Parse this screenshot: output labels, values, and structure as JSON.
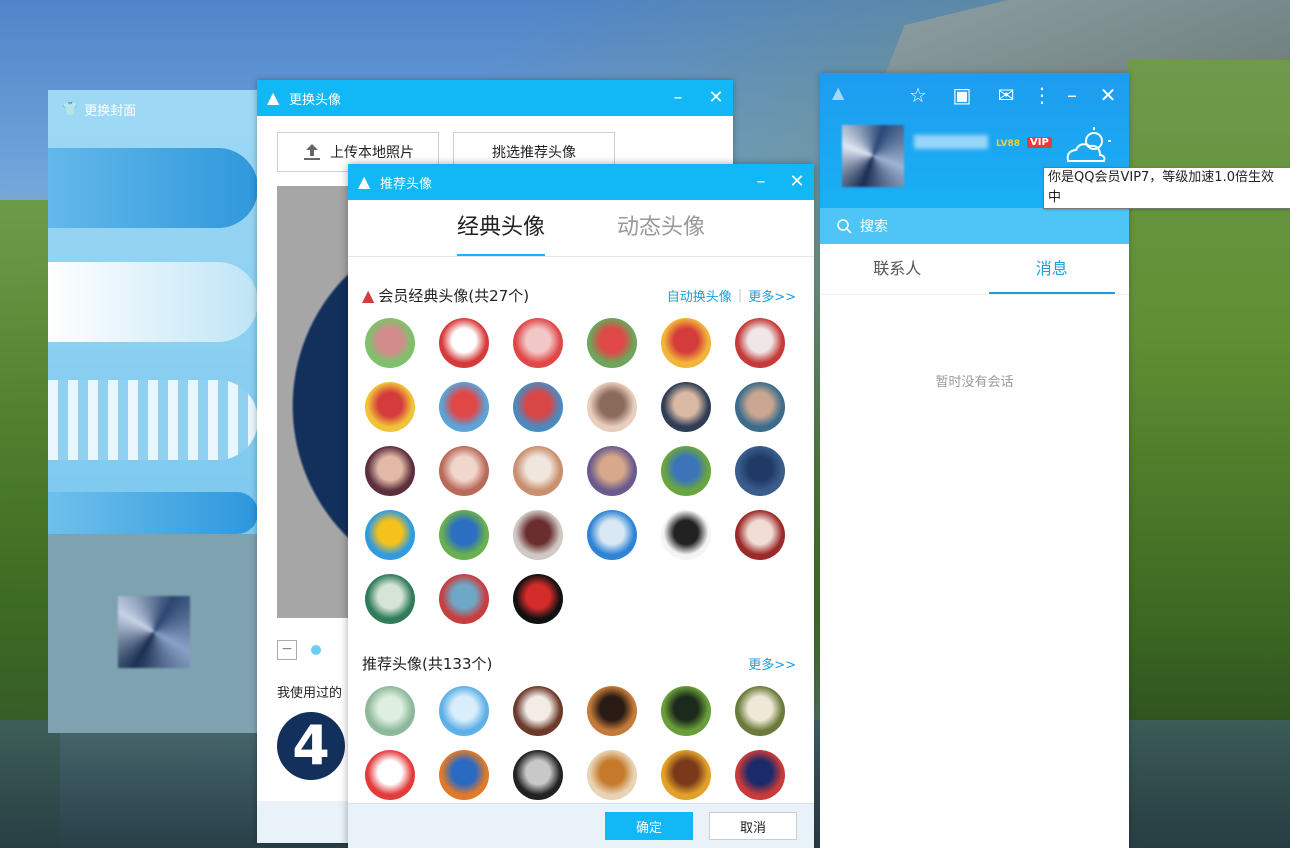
{
  "cover_window": {
    "title": "更换封面"
  },
  "change_avatar": {
    "title": "更换头像",
    "upload_button": "上传本地照片",
    "pick_button": "挑选推荐头像",
    "used_label": "我使用过的",
    "used_avatar_text": "4"
  },
  "recommend": {
    "title": "推荐头像",
    "tabs": [
      "经典头像",
      "动态头像"
    ],
    "vip_section": {
      "title": "会员经典头像(共27个)",
      "auto_link": "自动换头像",
      "more_link": "更多>>"
    },
    "rec_section": {
      "title": "推荐头像(共133个)",
      "more_link": "更多>>"
    },
    "ok_button": "确定",
    "cancel_button": "取消",
    "vip_avatars": [
      [
        "#7ec16a",
        "#d28c8c"
      ],
      [
        "#d63b3b",
        "#ffffff"
      ],
      [
        "#e04848",
        "#f2c7c7"
      ],
      [
        "#6da55a",
        "#e04848"
      ],
      [
        "#f2b53a",
        "#d43b3b"
      ],
      [
        "#c53b3b",
        "#f0e6e6"
      ],
      [
        "#f2c23a",
        "#d43b3b"
      ],
      [
        "#5ba3d8",
        "#e04848"
      ],
      [
        "#4b8ac0",
        "#d84646"
      ],
      [
        "#e9cdbd",
        "#8a6a5a"
      ],
      [
        "#2f3d55",
        "#d9b8a4"
      ],
      [
        "#3b6c8a",
        "#c9a690"
      ],
      [
        "#5b2f3e",
        "#e3b9a6"
      ],
      [
        "#b96b5a",
        "#f1d6cb"
      ],
      [
        "#c98f6e",
        "#f1e6de"
      ],
      [
        "#6b5a8c",
        "#d7a98a"
      ],
      [
        "#6aa63f",
        "#3b74b8"
      ],
      [
        "#3b5d8c",
        "#1f3a66"
      ],
      [
        "#2f9be0",
        "#f4c21a"
      ],
      [
        "#6ab04c",
        "#2b6ec2"
      ],
      [
        "#cfc8c4",
        "#6b2e2e"
      ],
      [
        "#2f83d6",
        "#d8e8f4"
      ],
      [
        "#f4f4f4",
        "#222222"
      ],
      [
        "#9b2a2a",
        "#f1ddd5"
      ],
      [
        "#2f7b5a",
        "#d6e4d8"
      ],
      [
        "#c73e3e",
        "#6fa7c7"
      ],
      [
        "#111111",
        "#d42b2b"
      ]
    ],
    "rec_avatars": [
      [
        "#8fb89a",
        "#dcefe0"
      ],
      [
        "#5fb0e8",
        "#d9eefb"
      ],
      [
        "#6b3a2a",
        "#f2ece5"
      ],
      [
        "#c47a3a",
        "#2a1b14"
      ],
      [
        "#6a9e3a",
        "#1b2a1b"
      ],
      [
        "#6a7a3a",
        "#efe8d6"
      ],
      [
        "#e33a3a",
        "#ffffff"
      ],
      [
        "#e07a2a",
        "#2a6ac2"
      ],
      [
        "#222222",
        "#c8c8c8"
      ],
      [
        "#e8d4b4",
        "#c47a2a"
      ],
      [
        "#e3a12a",
        "#7a3a1a"
      ],
      [
        "#c93a3a",
        "#1a2a6a"
      ]
    ]
  },
  "qq_main": {
    "level_text": "LV88",
    "vip_text": "VIP",
    "search_placeholder": "搜索",
    "tabs": [
      "联系人",
      "消息"
    ],
    "empty_text": "暂时没有会话"
  },
  "tooltip": {
    "text": "你是QQ会员VIP7，等级加速1.0倍生效中"
  }
}
